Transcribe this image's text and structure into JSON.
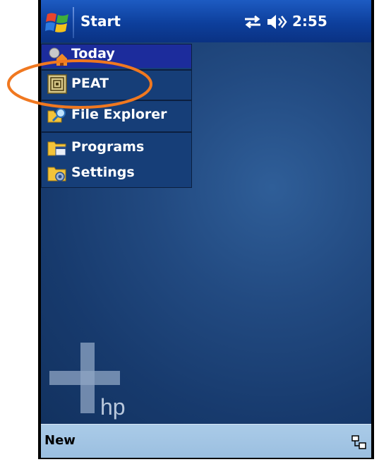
{
  "titlebar": {
    "start_label": "Start",
    "time": "2:55"
  },
  "start_menu": {
    "items": [
      {
        "label": "Today",
        "icon": "today-icon"
      },
      {
        "label": "PEAT",
        "icon": "peat-icon"
      },
      {
        "label": "File Explorer",
        "icon": "file-explorer-icon"
      },
      {
        "label": "Programs",
        "icon": "programs-folder-icon"
      },
      {
        "label": "Settings",
        "icon": "settings-folder-icon"
      }
    ]
  },
  "desktop": {
    "logo_text": "hp"
  },
  "menubar": {
    "new_label": "New"
  },
  "colors": {
    "annotation": "#f07820",
    "titlebar": "#0d3f9c",
    "today_highlight": "#1c2c9c"
  }
}
